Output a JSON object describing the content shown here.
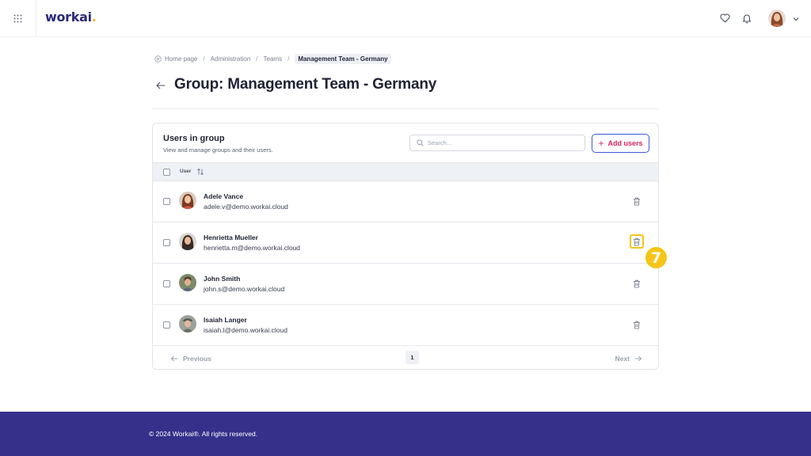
{
  "app": {
    "logo_text": "workai",
    "logo_dot": "."
  },
  "colors": {
    "brand": "#35318a",
    "accent_pink": "#d6245e",
    "accent_blue": "#3b5bdb",
    "highlight": "#f5c518"
  },
  "icons": {
    "apps": "grid-icon",
    "favorites": "heart-icon",
    "notifications": "bell-icon",
    "menu": "chevron-down-icon"
  },
  "breadcrumb": {
    "items": [
      "Home page",
      "Administration",
      "Teams"
    ],
    "current": "Management Team - Germany",
    "separator": "/"
  },
  "page": {
    "title": "Group: Management Team - Germany"
  },
  "card": {
    "title": "Users in group",
    "subtitle": "View and manage groups and their users.",
    "search_placeholder": "Search...",
    "add_button": "Add users",
    "column_user": "User"
  },
  "users": [
    {
      "name": "Adele Vance",
      "email": "adele.v@demo.workai.cloud"
    },
    {
      "name": "Henrietta Mueller",
      "email": "henrietta.m@demo.workai.cloud"
    },
    {
      "name": "John Smith",
      "email": "john.s@demo.workai.cloud"
    },
    {
      "name": "Isaiah Langer",
      "email": "isaiah.l@demo.workai.cloud"
    }
  ],
  "pagination": {
    "previous": "Previous",
    "next": "Next",
    "current_page": "1"
  },
  "annotation": {
    "step_number": "7"
  },
  "footer": {
    "text": "© 2024 Workai®. All rights reserved."
  }
}
